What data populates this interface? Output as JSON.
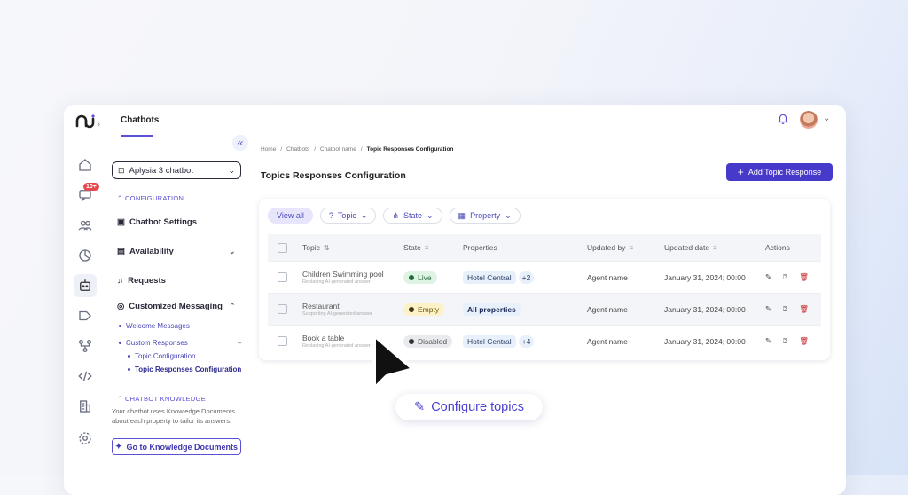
{
  "sidebar": {
    "tab": "Chatbots",
    "notification_badge": "10+",
    "bot_select": "Aplysia 3 chatbot",
    "config_section": "CONFIGURATION",
    "items": [
      {
        "label": "Chatbot Settings"
      },
      {
        "label": "Availability"
      },
      {
        "label": "Requests"
      },
      {
        "label": "Customized Messaging"
      }
    ],
    "subitems": [
      {
        "label": "Welcome Messages"
      },
      {
        "label": "Custom Responses"
      },
      {
        "label": "Topic Configuration"
      },
      {
        "label": "Topic Responses Configuration"
      }
    ],
    "knowledge_section": "CHATBOT KNOWLEDGE",
    "knowledge_desc": "Your chatbot uses Knowledge Documents about each property to tailor its answers.",
    "knowledge_button": "Go to Knowledge Documents"
  },
  "breadcrumb": [
    "Home",
    "Chatbots",
    "Chatbot name",
    "Topic Responses Configuration"
  ],
  "page_title": "Topics Responses Configuration",
  "add_button": "Add Topic Response",
  "filters": [
    "View all",
    "Topic",
    "State",
    "Property"
  ],
  "table": {
    "headers": [
      "Topic",
      "State",
      "Properties",
      "Updated by",
      "Updated date",
      "Actions"
    ],
    "rows": [
      {
        "topic": "Children Swimming pool",
        "sub": "Replacing AI-generated answer",
        "state": "Live",
        "property": "Hotel Central",
        "more": "+2",
        "updated_by": "Agent name",
        "date": "January 31, 2024; 00:00"
      },
      {
        "topic": "Restaurant",
        "sub": "Supporting AI-generated answer",
        "state": "Empty",
        "property": "All properties",
        "more": "",
        "updated_by": "Agent name",
        "date": "January 31, 2024; 00:00"
      },
      {
        "topic": "Book a table",
        "sub": "Replacing AI-generated answer",
        "state": "Disabled",
        "property": "Hotel Central",
        "more": "+4",
        "updated_by": "Agent name",
        "date": "January 31, 2024; 00:00"
      }
    ]
  },
  "callout": "Configure topics",
  "colors": {
    "accent": "#4739c9",
    "live": "#dff3e4",
    "empty": "#fdf1c8",
    "disabled": "#e9eaee"
  }
}
